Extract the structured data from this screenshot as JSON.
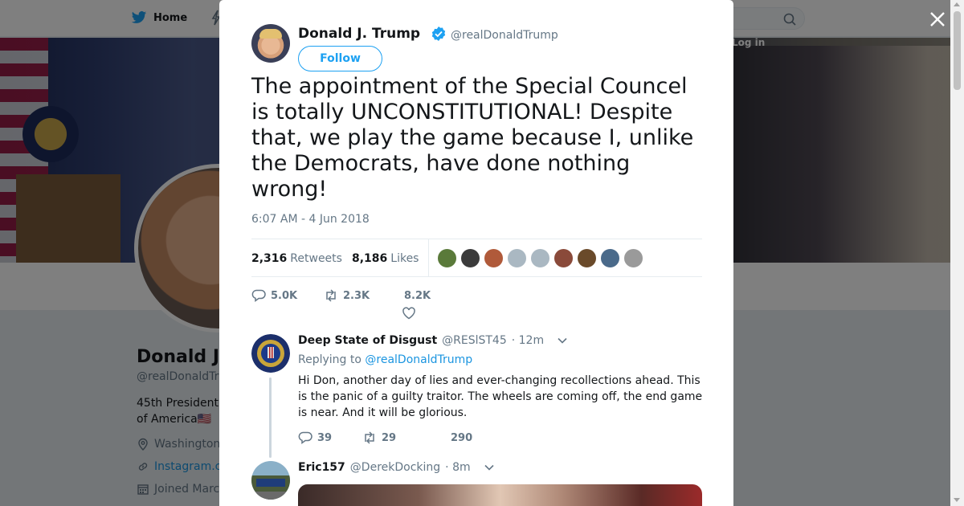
{
  "background": {
    "nav": {
      "home_label": "Home",
      "login_label": "Log in"
    },
    "profile": {
      "name": "Donald J.",
      "handle": "@realDonaldTr",
      "bio": "45th President of America",
      "flag": "🇺🇸",
      "location": "Washington",
      "link": "Instagram.c",
      "joined": "Joined Marc"
    }
  },
  "modal": {
    "author": {
      "name": "Donald J. Trump",
      "handle": "@realDonaldTrump",
      "verified": true
    },
    "follow_label": "Follow",
    "tweet_text": "The appointment of the Special Councel is totally UNCONSTITUTIONAL! Despite that, we play the game because I, unlike the Democrats, have done nothing wrong!",
    "timestamp": "6:07 AM - 4 Jun 2018",
    "stats": {
      "retweets_count": "2,316",
      "retweets_label": "Retweets",
      "likes_count": "8,186",
      "likes_label": "Likes"
    },
    "likers_colors": [
      "#5a7a3a",
      "#3b3b3b",
      "#b05a3a",
      "#aab8c2",
      "#aab8c2",
      "#8a4a3a",
      "#6a4a2a",
      "#4a6a8a",
      "#9a9a9a"
    ],
    "actions": {
      "replies": "5.0K",
      "retweets": "2.3K",
      "likes": "8.2K"
    },
    "replies": [
      {
        "name": "Deep State of Disgust",
        "handle": "@RESlST45",
        "time": "· 12m",
        "replying_prefix": "Replying to",
        "replying_to": "@realDonaldTrump",
        "text": "Hi Don, another day of lies and ever-changing recollections ahead. This is the panic of a guilty traitor. The wheels are coming off, the end game is near. And it will be glorious.",
        "counts": {
          "replies": "39",
          "retweets": "29",
          "likes": "290"
        }
      },
      {
        "name": "Eric157",
        "handle": "@DerekDocking",
        "time": "· 8m"
      }
    ]
  },
  "colors": {
    "accent": "#1da1f2",
    "text": "#14171a",
    "muted": "#657786"
  }
}
